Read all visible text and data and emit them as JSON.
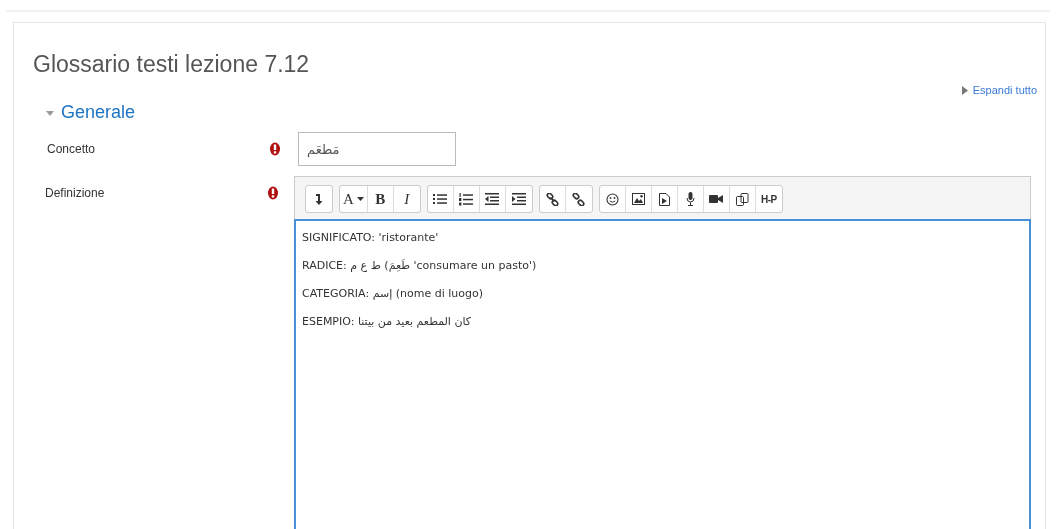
{
  "title": "Glossario testi lezione 7.12",
  "expand_all": {
    "label": "Espandi tutto"
  },
  "section": {
    "title": "Generale",
    "expanded": true
  },
  "fields": [
    {
      "kind": "text",
      "label": "Concetto",
      "required": true,
      "value": "مَطعَم"
    },
    {
      "kind": "editor",
      "label": "Definizione",
      "required": true,
      "toolbar": {
        "font_button": "A",
        "bold_button": "B",
        "italic_button": "I",
        "h5p_button": "H-P"
      },
      "paragraphs": [
        "SIGNIFICATO: 'ristorante'",
        "RADICE: ط ع م (طَعِمَ 'consumare un pasto')",
        "CATEGORIA: إسم (nome di luogo)",
        "ESEMPIO: كان المطعم بعيد من بيتنا"
      ]
    }
  ]
}
